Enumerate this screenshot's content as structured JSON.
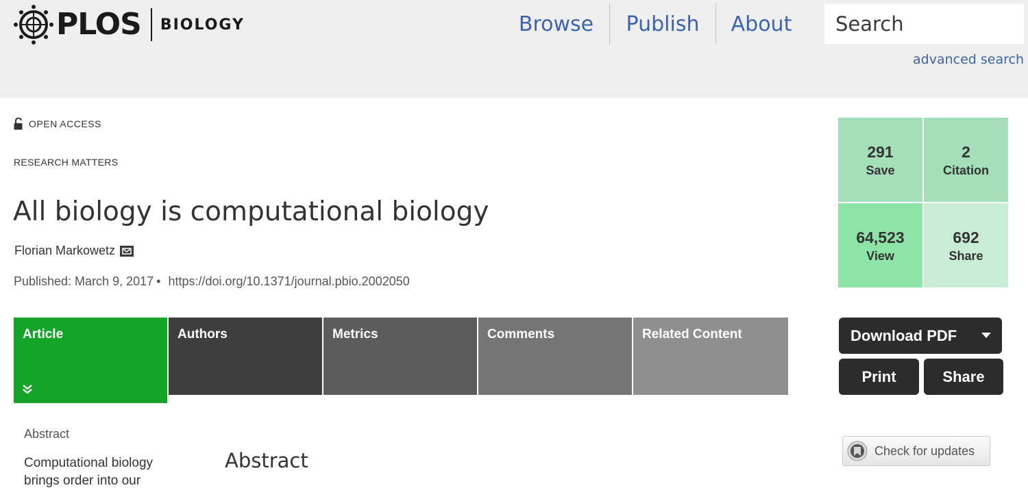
{
  "header": {
    "logo_text": "PLOS",
    "journal": "BIOLOGY",
    "nav": [
      {
        "label": "Browse"
      },
      {
        "label": "Publish"
      },
      {
        "label": "About"
      }
    ],
    "search": {
      "placeholder": "Search"
    },
    "advanced_search": "advanced search"
  },
  "article": {
    "access": "OPEN ACCESS",
    "section": "RESEARCH MATTERS",
    "title": "All biology is computational biology",
    "author": "Florian Markowetz",
    "published": "Published: March 9, 2017",
    "bullet": "•",
    "doi": "https://doi.org/10.1371/journal.pbio.2002050"
  },
  "tabs": [
    {
      "label": "Article"
    },
    {
      "label": "Authors"
    },
    {
      "label": "Metrics"
    },
    {
      "label": "Comments"
    },
    {
      "label": "Related Content"
    }
  ],
  "metrics": {
    "save": {
      "value": "291",
      "label": "Save"
    },
    "citation": {
      "value": "2",
      "label": "Citation"
    },
    "view": {
      "value": "64,523",
      "label": "View"
    },
    "share": {
      "value": "692",
      "label": "Share"
    }
  },
  "actions": {
    "download_pdf": "Download PDF",
    "print": "Print",
    "share": "Share",
    "check_updates": "Check for updates"
  },
  "toc": {
    "abstract": "Abstract",
    "snippet": "Computational biology brings order into our"
  },
  "content": {
    "abstract_heading": "Abstract"
  },
  "colors": {
    "nav_link": "#3c63af",
    "tab_active": "#16a32a",
    "metric_green": "#a5dfba",
    "button_dark": "#2c2c2c"
  }
}
